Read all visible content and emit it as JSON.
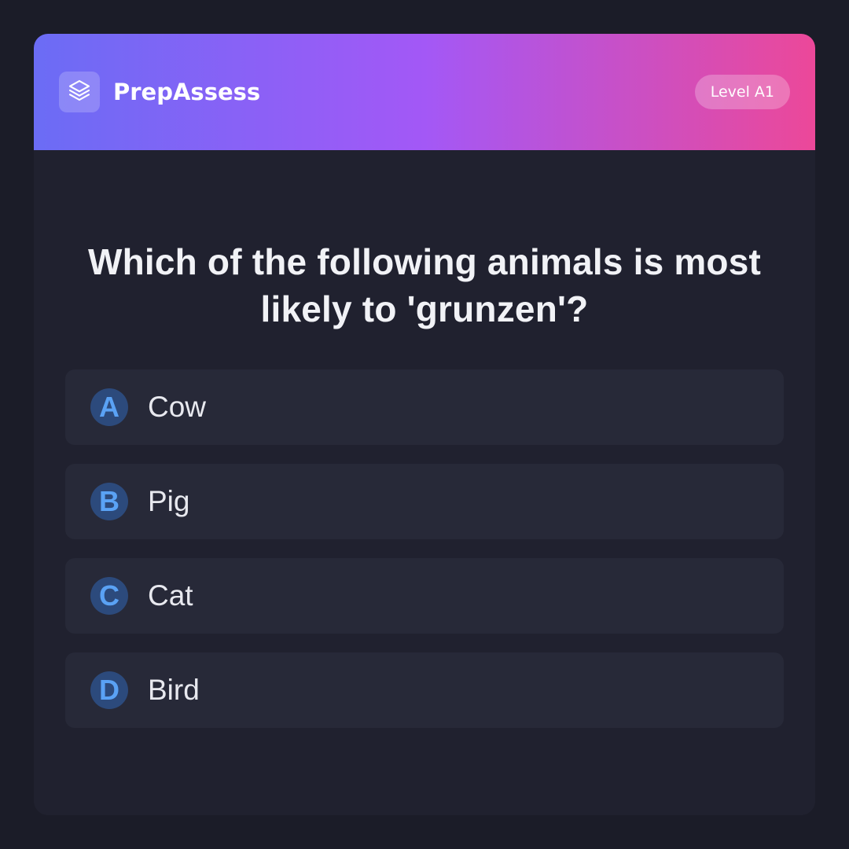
{
  "app": {
    "brand": "PrepAssess",
    "logo_icon": "layers-icon",
    "level_badge": "Level A1"
  },
  "colors": {
    "background": "#1b1c28",
    "card": "#20212f",
    "header_gradient": [
      "#6b6cf5",
      "#a358f6",
      "#ec4899"
    ],
    "option_background": "#272938",
    "option_letter_background": "#2c4a7c",
    "option_letter_text": "#5aa2f5"
  },
  "question": {
    "text": "Which of the following animals is most likely to 'grunzen'?"
  },
  "options": [
    {
      "letter": "A",
      "text": "Cow"
    },
    {
      "letter": "B",
      "text": "Pig"
    },
    {
      "letter": "C",
      "text": "Cat"
    },
    {
      "letter": "D",
      "text": "Bird"
    }
  ]
}
